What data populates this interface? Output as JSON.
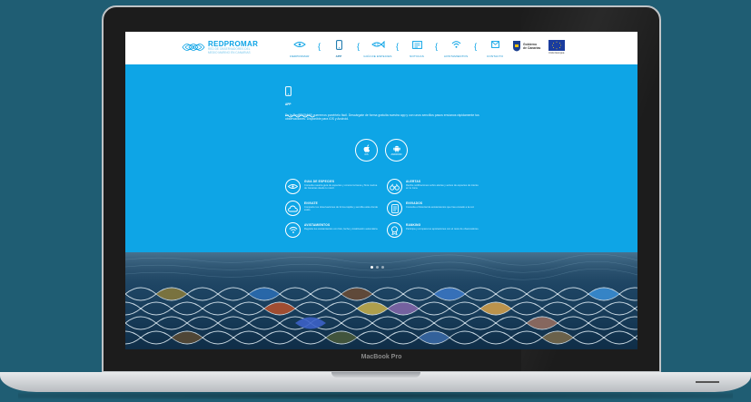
{
  "device": {
    "model": "MacBook Pro"
  },
  "site": {
    "logo": {
      "title": "REDPROMAR",
      "subtitle": "RED DE OBSERVADORES DEL MEDIO MARINO EN CANARIAS"
    },
    "nav": [
      {
        "label": "REDPROMAR",
        "icon": "fish-eye-icon"
      },
      {
        "label": "APP",
        "icon": "mobile-phone-icon",
        "active": true
      },
      {
        "label": "GUÍA DE ESPECIES",
        "icon": "fish-icon"
      },
      {
        "label": "NOTICIAS",
        "icon": "newspaper-icon"
      },
      {
        "label": "AVISTAMIENTOS",
        "icon": "wifi-signal-icon"
      },
      {
        "label": "CONTACTO",
        "icon": "envelope-icon"
      }
    ],
    "gov": {
      "line1": "Gobierno",
      "line2": "de Canarias"
    },
    "eu": {
      "caption": "Unión Europea"
    },
    "app_section": {
      "label": "APP",
      "intro": "En la RedPROMAR queremos ponértelo fácil. Descárgate de forma gratuita nuestra app y con unos sencillos pasos envíanos rápidamente tus observaciones. Disponible para iOS y Android.",
      "stores": [
        {
          "label": "iOS",
          "icon": "apple-icon"
        },
        {
          "label": "ANDROID",
          "icon": "android-icon"
        }
      ],
      "features": [
        {
          "title": "GUIA DE ESPECIES",
          "desc": "Consulta nuestra guía de especies y conoce la fauna y flora marina de Canarias desde tu móvil.",
          "icon": "fish-eye-icon"
        },
        {
          "title": "ALERTAS",
          "desc": "Recibe notificaciones sobre alertas y avisos de especies de interés en tu zona.",
          "icon": "binoculars-icon"
        },
        {
          "title": "ENVIATE",
          "desc": "Comparte tus observaciones de forma rápida y sencilla estés donde estés.",
          "icon": "cloud-icon"
        },
        {
          "title": "ENVIADOS",
          "desc": "Consulta el historial de avistamientos que has enviado a la red.",
          "icon": "document-icon"
        },
        {
          "title": "AVISTAMIENTOS",
          "desc": "Registra tus avistamientos con foto, fecha y localización automática.",
          "icon": "wifi-signal-icon"
        },
        {
          "title": "RANKING",
          "desc": "Participa y compara tus aportaciones con el resto de observadores.",
          "icon": "medal-icon"
        }
      ]
    }
  },
  "colors": {
    "brand_blue": "#0ea5e6",
    "laptop_frame": "#1c1c1c",
    "background": "#1f5d73"
  }
}
